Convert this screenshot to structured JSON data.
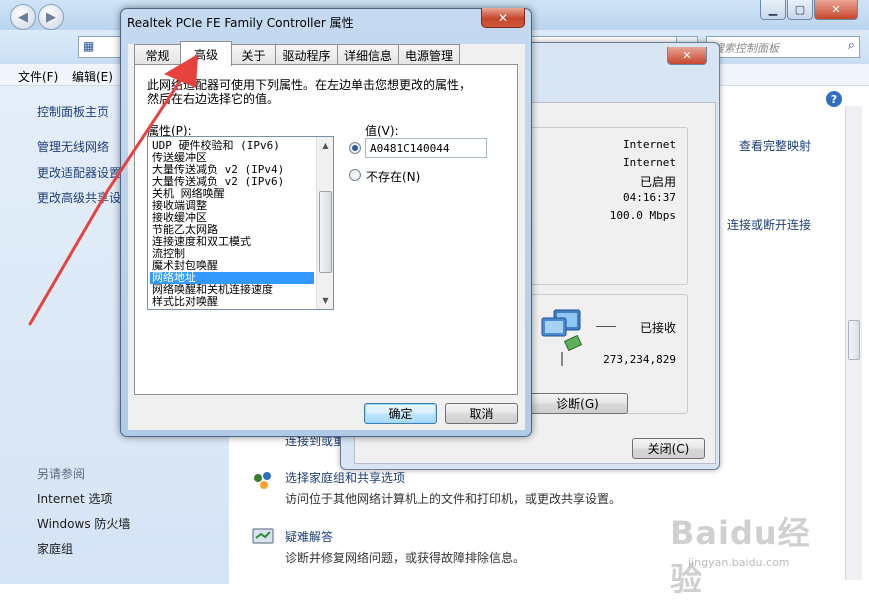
{
  "prop_dialog": {
    "title": "Realtek PCIe FE Family Controller 属性",
    "close_glyph": "✕",
    "tabs": [
      "常规",
      "高级",
      "关于",
      "驱动程序",
      "详细信息",
      "电源管理"
    ],
    "description_line1": "此网络适配器可使用下列属性。在左边单击您想更改的属性，",
    "description_line2": "然后在右边选择它的值。",
    "property_label": "属性(P):",
    "value_label": "值(V):",
    "properties": [
      "UDP 硬件校验和 (IPv6)",
      "传送缓冲区",
      "大量传送减负 v2 (IPv4)",
      "大量传送减负 v2 (IPv6)",
      "关机 网络唤醒",
      "接收端调整",
      "接收缓冲区",
      "节能乙太网路",
      "连接速度和双工模式",
      "流控制",
      "魔术封包唤醒",
      "网络地址",
      "网络唤醒和关机连接速度",
      "样式比对唤醒"
    ],
    "selected_property": "网络地址",
    "value_text": "A0481C140044",
    "not_present_label": "不存在(N)",
    "ok_label": "确定",
    "cancel_label": "取消"
  },
  "status_window": {
    "close_glyph": "✕",
    "ipv4_connectivity": "Internet",
    "ipv6_connectivity": "Internet",
    "media_state": "已启用",
    "duration": "04:16:37",
    "speed": "100.0 Mbps",
    "activity_status": "已接收",
    "bytes_received": "273,234,829",
    "diagnose_label": "诊断(G)",
    "close_label": "关闭(C)"
  },
  "control_panel": {
    "search_placeholder": "搜索控制面板",
    "menu": [
      "文件(F)",
      "编辑(E)"
    ],
    "sidebar_links": [
      "控制面板主页",
      "管理无线网络",
      "更改适配器设置",
      "更改高级共享设置"
    ],
    "see_also_header": "另请参阅",
    "see_also_links": [
      "Internet 选项",
      "Windows 防火墙",
      "家庭组"
    ],
    "right_links": [
      "查看完整映射",
      "连接或断开连接"
    ],
    "partial_text": "连接到或重",
    "homegroup_link": "选择家庭组和共享选项",
    "homegroup_desc": "访问位于其他网络计算机上的文件和打印机，或更改共享设置。",
    "troubleshoot_link": "疑难解答",
    "troubleshoot_desc": "诊断并修复网络问题，或获得故障排除信息。",
    "help_glyph": "?"
  },
  "watermark": {
    "logo": "Baidu经验",
    "url": "jingyan.baidu.com"
  },
  "colors": {
    "selection": "#3399ff",
    "arrow": "#e8423e",
    "link": "#1e3f7a"
  }
}
